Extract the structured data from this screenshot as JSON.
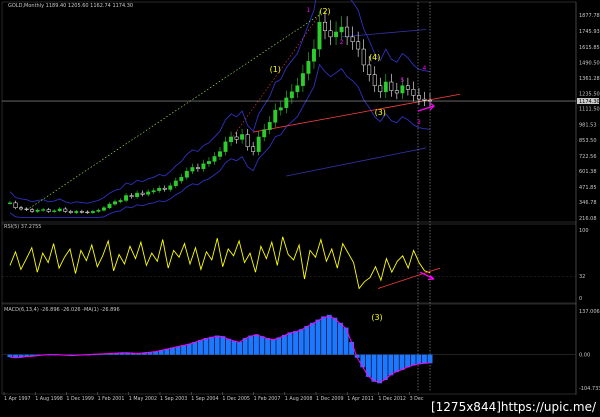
{
  "header": {
    "price": "GOLD,Monthly  1189.40 1205.60 1162.74 1174.30",
    "rsi": "RSI(5) 37.2755",
    "macd": "MACD(6,13,4) -26.896 -26.026 -MA(1) -26.896"
  },
  "watermark": "[1275x844]https://upic.me/",
  "colors": {
    "background": "#000000",
    "bull_candle": "#2ecc2e",
    "bear_candle": "#ffffff",
    "band": "#3030c0",
    "rsi": "#ffff00",
    "macd_hist": "#1e78ff",
    "macd_signal": "#ff00ff",
    "trend_line": "#ff4040",
    "wave_labels": "#ffff00",
    "arrow": "#ff00ff"
  },
  "annotations": {
    "wave_labels": [
      "(2)",
      "(1)",
      "(4)",
      "(3)",
      "(3)"
    ],
    "wave_small": [
      "1",
      "2",
      "3",
      "4",
      "5"
    ]
  },
  "chart_data": [
    {
      "type": "candlestick",
      "title": "GOLD,Monthly",
      "y_ticks": [
        "1877.78",
        "1745.93",
        "1615.85",
        "1490.50",
        "1361.28",
        "1235.50",
        "1111.50",
        "1174.30",
        "981.53",
        "853.50",
        "722.56",
        "601.38",
        "471.85",
        "346.78",
        "216.08"
      ],
      "current_price": "1174.30",
      "ylim": [
        216.08,
        1920
      ],
      "monthly_closes": [
        340,
        300,
        290,
        285,
        270,
        280,
        285,
        270,
        275,
        290,
        270,
        260,
        270,
        265,
        260,
        270,
        280,
        300,
        330,
        350,
        360,
        400,
        390,
        420,
        410,
        430,
        440,
        460,
        450,
        480,
        520,
        550,
        600,
        630,
        620,
        660,
        680,
        720,
        760,
        840,
        880,
        860,
        900,
        800,
        760,
        880,
        940,
        1000,
        1100,
        1120,
        1200,
        1250,
        1300,
        1400,
        1500,
        1600,
        1820,
        1750,
        1700,
        1740,
        1780,
        1700,
        1660,
        1600,
        1470,
        1390,
        1300,
        1250,
        1330,
        1260,
        1240,
        1300,
        1270,
        1220,
        1190,
        1180,
        1174
      ]
    },
    {
      "type": "line",
      "title": "RSI(5) 37.2755",
      "y_ticks": [
        "100",
        "32",
        "0"
      ],
      "ylim": [
        0,
        100
      ],
      "values": [
        48,
        68,
        42,
        58,
        74,
        38,
        66,
        52,
        80,
        44,
        60,
        72,
        36,
        70,
        55,
        78,
        46,
        62,
        84,
        40,
        64,
        50,
        76,
        58,
        82,
        48,
        66,
        54,
        86,
        44,
        70,
        60,
        80,
        50,
        74,
        42,
        68,
        56,
        88,
        46,
        72,
        62,
        84,
        52,
        66,
        38,
        76,
        58,
        82,
        48,
        90,
        64,
        56,
        78,
        28,
        70,
        60,
        86,
        54,
        72,
        44,
        80,
        66,
        52,
        14,
        24,
        30,
        46,
        26,
        58,
        38,
        54,
        62,
        44,
        70,
        52,
        40,
        37
      ]
    },
    {
      "type": "bar",
      "title": "MACD(6,13,4) -26.896 -26.026 -MA(1) -26.896",
      "y_ticks": [
        "137.006",
        "0.00",
        "-104.733"
      ],
      "ylim": [
        -104.733,
        137.006
      ],
      "values": [
        -8,
        -10,
        -9,
        -6,
        -5,
        -3,
        -1,
        0,
        0,
        -1,
        -2,
        -3,
        -2,
        -1,
        0,
        1,
        2,
        3,
        4,
        5,
        6,
        6,
        5,
        4,
        6,
        8,
        10,
        14,
        18,
        22,
        26,
        30,
        34,
        40,
        46,
        52,
        56,
        60,
        58,
        50,
        44,
        40,
        52,
        60,
        64,
        58,
        52,
        48,
        54,
        62,
        70,
        74,
        80,
        90,
        100,
        110,
        120,
        125,
        116,
        100,
        85,
        40,
        -10,
        -40,
        -70,
        -85,
        -90,
        -80,
        -65,
        -55,
        -48,
        -40,
        -34,
        -30,
        -28,
        -27
      ]
    }
  ],
  "x_ticks": [
    "1 Apr 1997",
    "1 Aug 1998",
    "1 Dec 1999",
    "1 Feb 2001",
    "1 May 2002",
    "1 Sep 2003",
    "1 Sep 2004",
    "1 Dec 2005",
    "1 Feb 2007",
    "1 Aug 2008",
    "1 Dec 2009",
    "1 Apr 2011",
    "1 Dec 2012",
    "3 Dec"
  ]
}
